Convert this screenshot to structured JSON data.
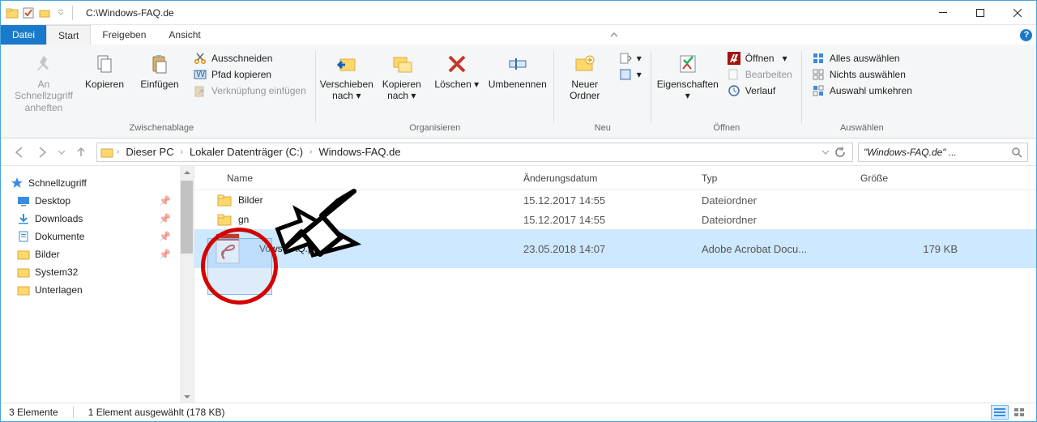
{
  "title": "C:\\Windows-FAQ.de",
  "tabs": {
    "file": "Datei",
    "start": "Start",
    "share": "Freigeben",
    "view": "Ansicht"
  },
  "ribbon": {
    "pin": {
      "label": "An Schnellzugriff anheften"
    },
    "copy": "Kopieren",
    "paste": "Einfügen",
    "cut": "Ausschneiden",
    "copypath": "Pfad kopieren",
    "shortcut": "Verknüpfung einfügen",
    "clipboard_group": "Zwischenablage",
    "moveto": "Verschieben nach",
    "copyto": "Kopieren nach",
    "delete": "Löschen",
    "rename": "Umbenennen",
    "organize_group": "Organisieren",
    "newfolder": "Neuer Ordner",
    "new_group": "Neu",
    "properties": "Eigenschaften",
    "open": "Öffnen",
    "edit": "Bearbeiten",
    "history": "Verlauf",
    "open_group": "Öffnen",
    "selall": "Alles auswählen",
    "selnone": "Nichts auswählen",
    "selinvert": "Auswahl umkehren",
    "select_group": "Auswählen"
  },
  "breadcrumb": [
    "Dieser PC",
    "Lokaler Datenträger (C:)",
    "Windows-FAQ.de"
  ],
  "search_placeholder": "\"Windows-FAQ.de\" ...",
  "nav": {
    "quick": "Schnellzugriff",
    "items": [
      "Desktop",
      "Downloads",
      "Dokumente",
      "Bilder",
      "System32",
      "Unterlagen"
    ]
  },
  "columns": {
    "name": "Name",
    "date": "Änderungsdatum",
    "type": "Typ",
    "size": "Größe"
  },
  "files": [
    {
      "name": "Bilder",
      "date": "15.12.2017 14:55",
      "type": "Dateiordner",
      "size": "",
      "kind": "folder"
    },
    {
      "name": "gn",
      "date": "15.12.2017 14:55",
      "type": "Dateiordner",
      "size": "",
      "kind": "folder"
    },
    {
      "name": "Vows-FAQ.pdf",
      "date": "23.05.2018 14:07",
      "type": "Adobe Acrobat Docu...",
      "size": "179 KB",
      "kind": "pdf",
      "selected": true
    }
  ],
  "status": {
    "count": "3 Elemente",
    "selected": "1 Element ausgewählt (178 KB)"
  }
}
